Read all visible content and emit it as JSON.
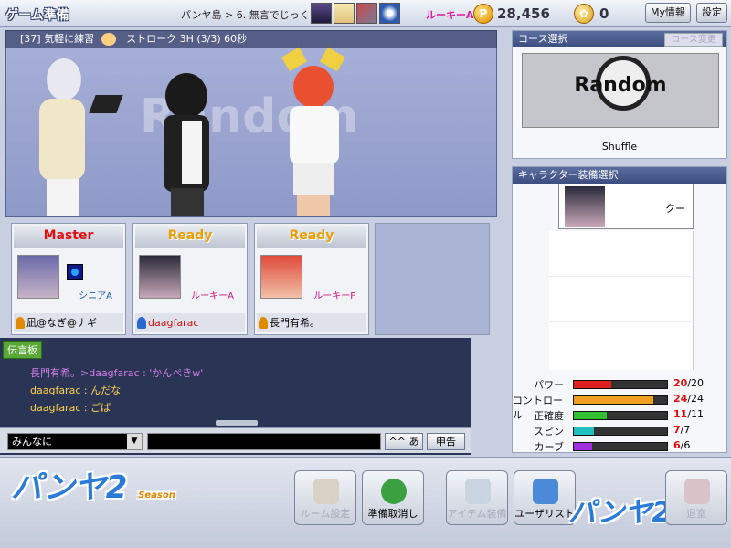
{
  "topbar": {
    "title": "ゲーム準備",
    "breadcrumb": "パンヤ島 > 6. 無言でじっくり",
    "rank": "ルーキーA",
    "pang": "28,456",
    "cookies": "0",
    "myinfo_label": "My情報",
    "settings_label": "設定"
  },
  "room": {
    "info": "[37] 気軽に練習",
    "mode": "ストローク  3H (3/3) 60秒",
    "stage_word": "Random"
  },
  "players": [
    {
      "status": "Master",
      "name": "シニアA",
      "user": "凪@なぎ@ナギ",
      "user_color": "#222222",
      "icon_color": "#e08a00"
    },
    {
      "status": "Ready",
      "name": "ルーキーA",
      "user": "daagfarac",
      "user_color": "#d11111",
      "icon_color": "#2a6ad0"
    },
    {
      "status": "Ready",
      "name": "ルーキーF",
      "user": "長門有希。",
      "user_color": "#222222",
      "icon_color": "#e08a00"
    }
  ],
  "chat": {
    "tab_label": "伝言板",
    "lines": [
      {
        "text": "長門有希。>daagfarac : 'かんぺきw'",
        "color": "#d27ee8"
      },
      {
        "text": "daagfarac : んだな",
        "color": "#ffd24a"
      },
      {
        "text": "daagfarac : ごば",
        "color": "#ffd24a"
      }
    ],
    "channel": "みんなに",
    "kana_label": "^^ あ",
    "report_label": "申告"
  },
  "course": {
    "title": "コース選択",
    "change_label": "コース変更",
    "image_word": "Random",
    "name": "Shuffle"
  },
  "equipment": {
    "title": "キャラクター装備選択",
    "character": "クー",
    "stats": [
      {
        "label": "パワー",
        "cur": "20",
        "max": "20",
        "fill": 0.4,
        "color": "#e02020"
      },
      {
        "label": "コントロール",
        "cur": "24",
        "max": "24",
        "fill": 0.85,
        "color": "#f0a020"
      },
      {
        "label": "正確度",
        "cur": "11",
        "max": "11",
        "fill": 0.35,
        "color": "#30c030"
      },
      {
        "label": "スピン",
        "cur": "7",
        "max": "7",
        "fill": 0.22,
        "color": "#20c0c0"
      },
      {
        "label": "カーブ",
        "cur": "6",
        "max": "6",
        "fill": 0.2,
        "color": "#a030e0"
      }
    ]
  },
  "buttons": {
    "room_settings": "ルーム設定",
    "cancel_ready": "準備取消し",
    "item_equip": "アイテム装備",
    "user_list": "ユーザリスト",
    "leave": "退室"
  },
  "logo": {
    "text": "パンヤ2",
    "season": "Season"
  }
}
